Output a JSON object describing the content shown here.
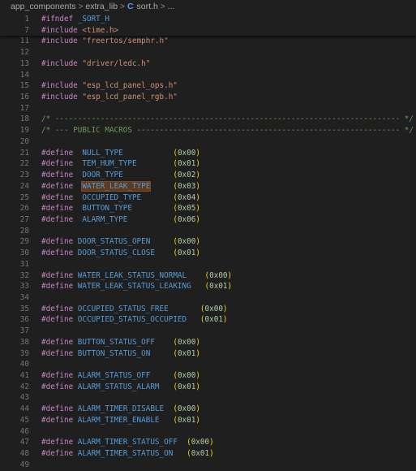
{
  "breadcrumb": {
    "items": [
      "app_components",
      "extra_lib",
      "sort.h",
      "..."
    ],
    "separator": ">",
    "file_icon": "C"
  },
  "colors": {
    "background": "#1f1f1f",
    "line_number": "#6e7681",
    "preprocessor": "#c586c0",
    "string": "#ce9178",
    "comment": "#6a9955",
    "macro": "#569cd6",
    "number": "#b5cea8",
    "paren": "#ffd700",
    "highlight": "#5e3a1e"
  },
  "sticky_lines": [
    {
      "num": "1",
      "segs": [
        {
          "t": "#ifndef",
          "c": "kw"
        },
        {
          "t": " _SORT_H",
          "c": "mac"
        }
      ]
    },
    {
      "num": "7",
      "segs": [
        {
          "t": "#include",
          "c": "kw"
        },
        {
          "t": " <time.h>",
          "c": "str"
        }
      ]
    }
  ],
  "lines": [
    {
      "num": "11",
      "segs": [
        {
          "t": "#include",
          "c": "kw"
        },
        {
          "t": " \"freertos/semphr.h\"",
          "c": "str"
        }
      ]
    },
    {
      "num": "12",
      "segs": []
    },
    {
      "num": "13",
      "segs": [
        {
          "t": "#include",
          "c": "kw"
        },
        {
          "t": " \"driver/ledc.h\"",
          "c": "str"
        }
      ]
    },
    {
      "num": "14",
      "segs": []
    },
    {
      "num": "15",
      "segs": [
        {
          "t": "#include",
          "c": "kw"
        },
        {
          "t": " \"esp_lcd_panel_ops.h\"",
          "c": "str"
        }
      ]
    },
    {
      "num": "16",
      "segs": [
        {
          "t": "#include",
          "c": "kw"
        },
        {
          "t": " \"esp_lcd_panel_rgb.h\"",
          "c": "str"
        }
      ]
    },
    {
      "num": "17",
      "segs": []
    },
    {
      "num": "18",
      "segs": [
        {
          "t": "/* ---------------------------------------------------------------------------- */",
          "c": "cm"
        }
      ]
    },
    {
      "num": "19",
      "segs": [
        {
          "t": "/* --- PUBLIC MACROS ---------------------------------------------------------- */",
          "c": "cm"
        }
      ]
    },
    {
      "num": "20",
      "segs": []
    },
    {
      "num": "21",
      "segs": [
        {
          "t": "#define",
          "c": "kw"
        },
        {
          "t": "  NULL_TYPE           ",
          "c": "mac"
        },
        {
          "t": "(",
          "c": "par"
        },
        {
          "t": "0x00",
          "c": "hex"
        },
        {
          "t": ")",
          "c": "par"
        }
      ]
    },
    {
      "num": "22",
      "segs": [
        {
          "t": "#define",
          "c": "kw"
        },
        {
          "t": "  TEM_HUM_TYPE        ",
          "c": "mac"
        },
        {
          "t": "(",
          "c": "par"
        },
        {
          "t": "0x01",
          "c": "hex"
        },
        {
          "t": ")",
          "c": "par"
        }
      ]
    },
    {
      "num": "23",
      "segs": [
        {
          "t": "#define",
          "c": "kw"
        },
        {
          "t": "  DOOR_TYPE           ",
          "c": "mac"
        },
        {
          "t": "(",
          "c": "par"
        },
        {
          "t": "0x02",
          "c": "hex"
        },
        {
          "t": ")",
          "c": "par"
        }
      ]
    },
    {
      "num": "24",
      "segs": [
        {
          "t": "#define",
          "c": "kw"
        },
        {
          "t": "  ",
          "c": "mac"
        },
        {
          "t": "WATER_LEAK_TYPE",
          "c": "mac hl"
        },
        {
          "t": "     ",
          "c": "mac"
        },
        {
          "t": "(",
          "c": "par"
        },
        {
          "t": "0x03",
          "c": "hex"
        },
        {
          "t": ")",
          "c": "par"
        }
      ]
    },
    {
      "num": "25",
      "segs": [
        {
          "t": "#define",
          "c": "kw"
        },
        {
          "t": "  OCCUPIED_TYPE       ",
          "c": "mac"
        },
        {
          "t": "(",
          "c": "par"
        },
        {
          "t": "0x04",
          "c": "hex"
        },
        {
          "t": ")",
          "c": "par"
        }
      ]
    },
    {
      "num": "26",
      "segs": [
        {
          "t": "#define",
          "c": "kw"
        },
        {
          "t": "  BUTTON_TYPE         ",
          "c": "mac"
        },
        {
          "t": "(",
          "c": "par"
        },
        {
          "t": "0x05",
          "c": "hex"
        },
        {
          "t": ")",
          "c": "par"
        }
      ]
    },
    {
      "num": "27",
      "segs": [
        {
          "t": "#define",
          "c": "kw"
        },
        {
          "t": "  ALARM_TYPE          ",
          "c": "mac"
        },
        {
          "t": "(",
          "c": "par"
        },
        {
          "t": "0x06",
          "c": "hex"
        },
        {
          "t": ")",
          "c": "par"
        }
      ]
    },
    {
      "num": "28",
      "segs": []
    },
    {
      "num": "29",
      "segs": [
        {
          "t": "#define",
          "c": "kw"
        },
        {
          "t": " DOOR_STATUS_OPEN     ",
          "c": "mac"
        },
        {
          "t": "(",
          "c": "par"
        },
        {
          "t": "0x00",
          "c": "hex"
        },
        {
          "t": ")",
          "c": "par"
        }
      ]
    },
    {
      "num": "30",
      "segs": [
        {
          "t": "#define",
          "c": "kw"
        },
        {
          "t": " DOOR_STATUS_CLOSE    ",
          "c": "mac"
        },
        {
          "t": "(",
          "c": "par"
        },
        {
          "t": "0x01",
          "c": "hex"
        },
        {
          "t": ")",
          "c": "par"
        }
      ]
    },
    {
      "num": "31",
      "segs": []
    },
    {
      "num": "32",
      "segs": [
        {
          "t": "#define",
          "c": "kw"
        },
        {
          "t": " WATER_LEAK_STATUS_NORMAL    ",
          "c": "mac"
        },
        {
          "t": "(",
          "c": "par"
        },
        {
          "t": "0x00",
          "c": "hex"
        },
        {
          "t": ")",
          "c": "par"
        }
      ]
    },
    {
      "num": "33",
      "segs": [
        {
          "t": "#define",
          "c": "kw"
        },
        {
          "t": " WATER_LEAK_STATUS_LEAKING   ",
          "c": "mac"
        },
        {
          "t": "(",
          "c": "par"
        },
        {
          "t": "0x01",
          "c": "hex"
        },
        {
          "t": ")",
          "c": "par"
        }
      ]
    },
    {
      "num": "34",
      "segs": []
    },
    {
      "num": "35",
      "segs": [
        {
          "t": "#define",
          "c": "kw"
        },
        {
          "t": " OCCUPIED_STATUS_FREE       ",
          "c": "mac"
        },
        {
          "t": "(",
          "c": "par"
        },
        {
          "t": "0x00",
          "c": "hex"
        },
        {
          "t": ")",
          "c": "par"
        }
      ]
    },
    {
      "num": "36",
      "segs": [
        {
          "t": "#define",
          "c": "kw"
        },
        {
          "t": " OCCUPIED_STATUS_OCCUPIED   ",
          "c": "mac"
        },
        {
          "t": "(",
          "c": "par"
        },
        {
          "t": "0x01",
          "c": "hex"
        },
        {
          "t": ")",
          "c": "par"
        }
      ]
    },
    {
      "num": "37",
      "segs": []
    },
    {
      "num": "38",
      "segs": [
        {
          "t": "#define",
          "c": "kw"
        },
        {
          "t": " BUTTON_STATUS_OFF    ",
          "c": "mac"
        },
        {
          "t": "(",
          "c": "par"
        },
        {
          "t": "0x00",
          "c": "hex"
        },
        {
          "t": ")",
          "c": "par"
        }
      ]
    },
    {
      "num": "39",
      "segs": [
        {
          "t": "#define",
          "c": "kw"
        },
        {
          "t": " BUTTON_STATUS_ON     ",
          "c": "mac"
        },
        {
          "t": "(",
          "c": "par"
        },
        {
          "t": "0x01",
          "c": "hex"
        },
        {
          "t": ")",
          "c": "par"
        }
      ]
    },
    {
      "num": "40",
      "segs": []
    },
    {
      "num": "41",
      "segs": [
        {
          "t": "#define",
          "c": "kw"
        },
        {
          "t": " ALARM_STATUS_OFF     ",
          "c": "mac"
        },
        {
          "t": "(",
          "c": "par"
        },
        {
          "t": "0x00",
          "c": "hex"
        },
        {
          "t": ")",
          "c": "par"
        }
      ]
    },
    {
      "num": "42",
      "segs": [
        {
          "t": "#define",
          "c": "kw"
        },
        {
          "t": " ALARM_STATUS_ALARM   ",
          "c": "mac"
        },
        {
          "t": "(",
          "c": "par"
        },
        {
          "t": "0x01",
          "c": "hex"
        },
        {
          "t": ")",
          "c": "par"
        }
      ]
    },
    {
      "num": "43",
      "segs": []
    },
    {
      "num": "44",
      "segs": [
        {
          "t": "#define",
          "c": "kw"
        },
        {
          "t": " ALARM_TIMER_DISABLE  ",
          "c": "mac"
        },
        {
          "t": "(",
          "c": "par"
        },
        {
          "t": "0x00",
          "c": "hex"
        },
        {
          "t": ")",
          "c": "par"
        }
      ]
    },
    {
      "num": "45",
      "segs": [
        {
          "t": "#define",
          "c": "kw"
        },
        {
          "t": " ALARM_TIMER_ENABLE   ",
          "c": "mac"
        },
        {
          "t": "(",
          "c": "par"
        },
        {
          "t": "0x01",
          "c": "hex"
        },
        {
          "t": ")",
          "c": "par"
        }
      ]
    },
    {
      "num": "46",
      "segs": []
    },
    {
      "num": "47",
      "segs": [
        {
          "t": "#define",
          "c": "kw"
        },
        {
          "t": " ALARM_TIMER_STATUS_OFF  ",
          "c": "mac"
        },
        {
          "t": "(",
          "c": "par"
        },
        {
          "t": "0x00",
          "c": "hex"
        },
        {
          "t": ")",
          "c": "par"
        }
      ]
    },
    {
      "num": "48",
      "segs": [
        {
          "t": "#define",
          "c": "kw"
        },
        {
          "t": " ALARM_TIMER_STATUS_ON   ",
          "c": "mac"
        },
        {
          "t": "(",
          "c": "par"
        },
        {
          "t": "0x01",
          "c": "hex"
        },
        {
          "t": ")",
          "c": "par"
        }
      ]
    },
    {
      "num": "49",
      "segs": []
    }
  ]
}
